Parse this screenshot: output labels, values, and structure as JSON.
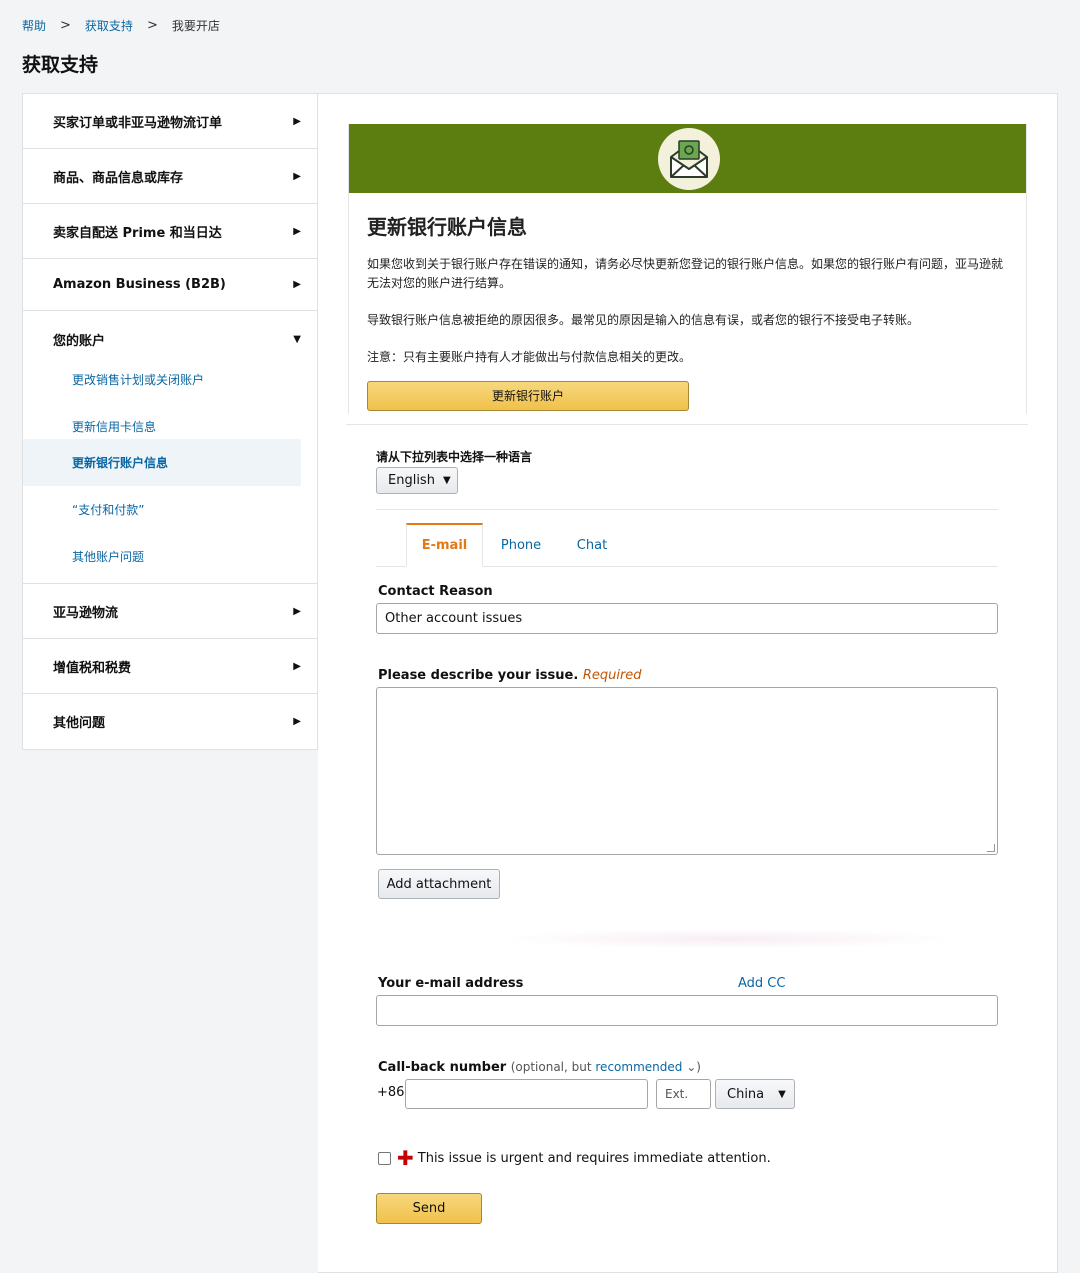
{
  "breadcrumb": {
    "items": [
      "帮助",
      "获取支持",
      "我要开店"
    ],
    "separator": ">"
  },
  "page_title": "获取支持",
  "sidebar": {
    "items": [
      {
        "label": "买家订单或非亚马逊物流订单",
        "icon": "triangle-right-icon"
      },
      {
        "label": "商品、商品信息或库存",
        "icon": "triangle-right-icon"
      },
      {
        "label": "卖家自配送 Prime 和当日达",
        "icon": "triangle-right-icon"
      },
      {
        "label": "Amazon Business (B2B)",
        "icon": "triangle-right-icon"
      },
      {
        "label": "您的账户",
        "icon": "triangle-down-icon",
        "expanded": true
      },
      {
        "label": "亚马逊物流",
        "icon": "triangle-right-icon"
      },
      {
        "label": "增值税和税费",
        "icon": "triangle-right-icon"
      },
      {
        "label": "其他问题",
        "icon": "triangle-right-icon"
      }
    ],
    "sub_items": [
      "更改销售计划或关闭账户",
      "更新信用卡信息",
      "更新银行账户信息",
      "“支付和付款”",
      "其他账户问题"
    ],
    "active_sub_item": "更新银行账户信息"
  },
  "card": {
    "banner_color": "#5c7e10",
    "banner_icon": "money-envelope-icon",
    "title": "更新银行账户信息",
    "paragraph1": "如果您收到关于银行账户存在错误的通知，请务必尽快更新您登记的银行账户信息。如果您的银行账户有问题，亚马逊就无法对您的账户进行结算。",
    "paragraph2": "导致银行账户信息被拒绝的原因很多。最常见的原因是输入的信息有误，或者您的银行不接受电子转账。",
    "paragraph3": "注意：只有主要账户持有人才能做出与付款信息相关的更改。",
    "button_label": "更新银行账户"
  },
  "language": {
    "label": "请从下拉列表中选择一种语言",
    "selected": "English",
    "chevron": "⌄"
  },
  "tabs": {
    "email": "E-mail",
    "phone": "Phone",
    "chat": "Chat",
    "active": "E-mail"
  },
  "form": {
    "contact_reason_label": "Contact Reason",
    "contact_reason_value": "Other account issues",
    "describe_label": "Please describe your issue.",
    "required_text": "Required",
    "attachment_button": "Add attachment",
    "email_label": "Your e-mail address",
    "add_cc": "Add CC",
    "callback_label": "Call-back number",
    "callback_optional_prefix": "(optional, but ",
    "callback_recommended": "recommended",
    "callback_optional_suffix": " ⌄)",
    "country_code": "+86",
    "ext_placeholder": "Ext.",
    "country": "China",
    "urgent_text": "This issue is urgent and requires immediate attention.",
    "send_button": "Send"
  },
  "colors": {
    "link": "#0a67a3",
    "active_tab": "#e47911",
    "required": "#c45500",
    "button_yellow": "#f0c14b",
    "urgent_cross": "#c40000"
  }
}
